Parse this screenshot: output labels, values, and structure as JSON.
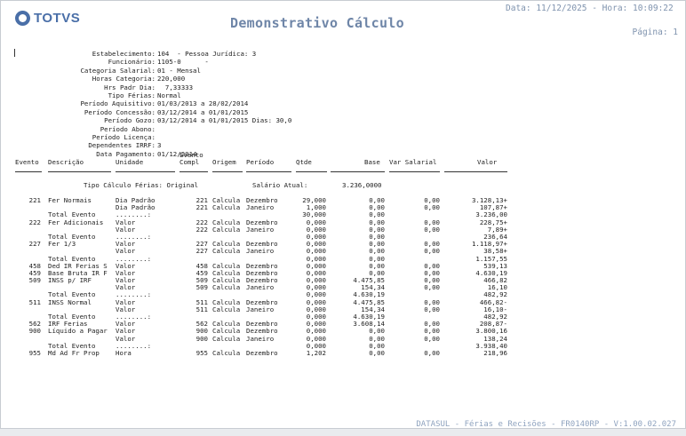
{
  "header": {
    "logo_text": "TOTVS",
    "title": "Demonstrativo Cálculo",
    "date_line": "Data: 11/12/2025 - Hora: 10:09:22",
    "page_line": "Página: 1"
  },
  "info": [
    {
      "label": "Estabelecimento:",
      "value": "104  - Pessoa Jurídica: 3"
    },
    {
      "label": "Funcionário:",
      "value": "1105-0      -"
    },
    {
      "label": "Categoria Salarial:",
      "value": "01 - Mensal"
    },
    {
      "label": "Horas Categoria:",
      "value": "220,000"
    },
    {
      "label": "Hrs Padr Dia:",
      "value": "  7,33333"
    },
    {
      "label": "Tipo Férias:",
      "value": "Normal"
    },
    {
      "label": "Período Aquisitivo:",
      "value": "01/03/2013 a 28/02/2014"
    },
    {
      "label": "Período Concessão:",
      "value": "03/12/2014 a 01/01/2015"
    },
    {
      "label": "Período Gozo:",
      "value": "03/12/2014 a 01/01/2015 Dias: 30,0"
    },
    {
      "label": "Período Abono:",
      "value": ""
    },
    {
      "label": "Período Licença:",
      "value": ""
    },
    {
      "label": "Dependentes IRRF:",
      "value": "3"
    },
    {
      "label": "Data Pagamento:",
      "value": "01/12/2014"
    }
  ],
  "columns": {
    "evento": "Evento",
    "descricao": "Descrição",
    "unidade": "Unidade",
    "evento_compl_1": "Evento",
    "evento_compl_2": "Compl",
    "origem": "Origem",
    "periodo": "Período",
    "qtde": "Qtde",
    "base": "Base",
    "var_salarial": "Var Salarial",
    "valor": "Valor"
  },
  "ferias_info": {
    "tipo": "Tipo Cálculo Férias: Original",
    "salario_label": "Salário Atual:",
    "salario_value": "3.236,0000"
  },
  "rows": [
    {
      "ev": "221",
      "desc": "Fer Normais",
      "uni": "Dia Padrão",
      "compl": "221",
      "orig": "Calcula",
      "per": "Dezembro",
      "qtde": "29,000",
      "base": "0,00",
      "var": "0,00",
      "valor": "3.128,13+"
    },
    {
      "ev": "",
      "desc": "",
      "uni": "Dia Padrão",
      "compl": "221",
      "orig": "Calcula",
      "per": "Janeiro",
      "qtde": "1,000",
      "base": "0,00",
      "var": "0,00",
      "valor": "107,87+"
    },
    {
      "ev": "",
      "desc": "Total Evento",
      "uni": "........:",
      "compl": "",
      "orig": "",
      "per": "",
      "qtde": "30,000",
      "base": "0,00",
      "var": "",
      "valor": "3.236,00"
    },
    {
      "ev": "222",
      "desc": "Fer Adicionais",
      "uni": "Valor",
      "compl": "222",
      "orig": "Calcula",
      "per": "Dezembro",
      "qtde": "0,000",
      "base": "0,00",
      "var": "0,00",
      "valor": "228,75+"
    },
    {
      "ev": "",
      "desc": "",
      "uni": "Valor",
      "compl": "222",
      "orig": "Calcula",
      "per": "Janeiro",
      "qtde": "0,000",
      "base": "0,00",
      "var": "0,00",
      "valor": "7,89+"
    },
    {
      "ev": "",
      "desc": "Total Evento",
      "uni": "........:",
      "compl": "",
      "orig": "",
      "per": "",
      "qtde": "0,000",
      "base": "0,00",
      "var": "",
      "valor": "236,64"
    },
    {
      "ev": "227",
      "desc": "Fer 1/3",
      "uni": "Valor",
      "compl": "227",
      "orig": "Calcula",
      "per": "Dezembro",
      "qtde": "0,000",
      "base": "0,00",
      "var": "0,00",
      "valor": "1.118,97+"
    },
    {
      "ev": "",
      "desc": "",
      "uni": "Valor",
      "compl": "227",
      "orig": "Calcula",
      "per": "Janeiro",
      "qtde": "0,000",
      "base": "0,00",
      "var": "0,00",
      "valor": "38,58+"
    },
    {
      "ev": "",
      "desc": "Total Evento",
      "uni": "........:",
      "compl": "",
      "orig": "",
      "per": "",
      "qtde": "0,000",
      "base": "0,00",
      "var": "",
      "valor": "1.157,55"
    },
    {
      "ev": "458",
      "desc": "Ded IR Ferias S",
      "uni": "Valor",
      "compl": "458",
      "orig": "Calcula",
      "per": "Dezembro",
      "qtde": "0,000",
      "base": "0,00",
      "var": "0,00",
      "valor": "539,13"
    },
    {
      "ev": "459",
      "desc": "Base Bruta IR F",
      "uni": "Valor",
      "compl": "459",
      "orig": "Calcula",
      "per": "Dezembro",
      "qtde": "0,000",
      "base": "0,00",
      "var": "0,00",
      "valor": "4.630,19"
    },
    {
      "ev": "509",
      "desc": "INSS p/ IRF",
      "uni": "Valor",
      "compl": "509",
      "orig": "Calcula",
      "per": "Dezembro",
      "qtde": "0,000",
      "base": "4.475,85",
      "var": "0,00",
      "valor": "466,82"
    },
    {
      "ev": "",
      "desc": "",
      "uni": "Valor",
      "compl": "509",
      "orig": "Calcula",
      "per": "Janeiro",
      "qtde": "0,000",
      "base": "154,34",
      "var": "0,00",
      "valor": "16,10"
    },
    {
      "ev": "",
      "desc": "Total Evento",
      "uni": "........:",
      "compl": "",
      "orig": "",
      "per": "",
      "qtde": "0,000",
      "base": "4.630,19",
      "var": "",
      "valor": "482,92"
    },
    {
      "ev": "511",
      "desc": "INSS Normal",
      "uni": "Valor",
      "compl": "511",
      "orig": "Calcula",
      "per": "Dezembro",
      "qtde": "0,000",
      "base": "4.475,85",
      "var": "0,00",
      "valor": "466,82-"
    },
    {
      "ev": "",
      "desc": "",
      "uni": "Valor",
      "compl": "511",
      "orig": "Calcula",
      "per": "Janeiro",
      "qtde": "0,000",
      "base": "154,34",
      "var": "0,00",
      "valor": "16,10-"
    },
    {
      "ev": "",
      "desc": "Total Evento",
      "uni": "........:",
      "compl": "",
      "orig": "",
      "per": "",
      "qtde": "0,000",
      "base": "4.630,19",
      "var": "",
      "valor": "482,92"
    },
    {
      "ev": "562",
      "desc": "IRF Ferias",
      "uni": "Valor",
      "compl": "562",
      "orig": "Calcula",
      "per": "Dezembro",
      "qtde": "0,000",
      "base": "3.608,14",
      "var": "0,00",
      "valor": "208,87-"
    },
    {
      "ev": "900",
      "desc": "Líquido a Pagar",
      "uni": "Valor",
      "compl": "900",
      "orig": "Calcula",
      "per": "Dezembro",
      "qtde": "0,000",
      "base": "0,00",
      "var": "0,00",
      "valor": "3.800,16"
    },
    {
      "ev": "",
      "desc": "",
      "uni": "Valor",
      "compl": "900",
      "orig": "Calcula",
      "per": "Janeiro",
      "qtde": "0,000",
      "base": "0,00",
      "var": "0,00",
      "valor": "138,24"
    },
    {
      "ev": "",
      "desc": "Total Evento",
      "uni": "........:",
      "compl": "",
      "orig": "",
      "per": "",
      "qtde": "0,000",
      "base": "0,00",
      "var": "",
      "valor": "3.938,40"
    },
    {
      "ev": "955",
      "desc": "Md Ad Fr Prop",
      "uni": "Hora",
      "compl": "955",
      "orig": "Calcula",
      "per": "Dezembro",
      "qtde": "1,202",
      "base": "0,00",
      "var": "0,00",
      "valor": "218,96"
    }
  ],
  "footer": "DATASUL - Férias e Recisões - FR0140RP - V:1.00.02.027"
}
